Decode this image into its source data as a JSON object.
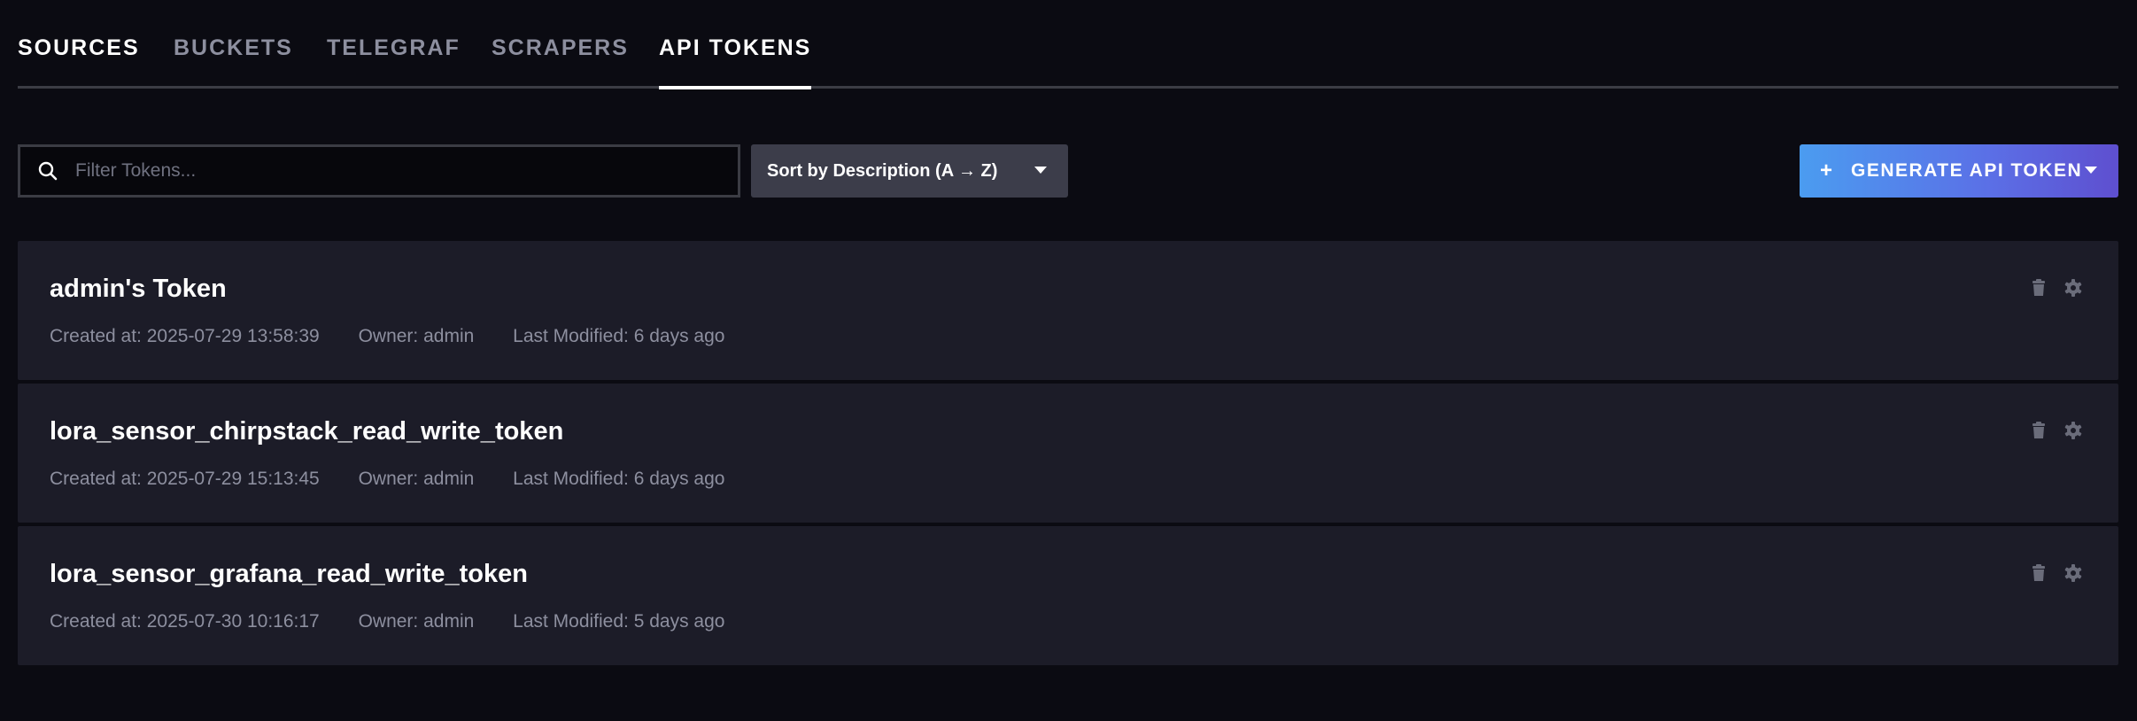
{
  "tabs": [
    {
      "label": "SOURCES",
      "state": "inactive-bright"
    },
    {
      "label": "BUCKETS",
      "state": "inactive"
    },
    {
      "label": "TELEGRAF",
      "state": "inactive"
    },
    {
      "label": "SCRAPERS",
      "state": "inactive"
    },
    {
      "label": "API TOKENS",
      "state": "active"
    }
  ],
  "toolbar": {
    "search_placeholder": "Filter Tokens...",
    "search_icon": "search-icon",
    "sort_label": "Sort by Description (A → Z)",
    "generate_label": "GENERATE API TOKEN",
    "generate_plus": "+"
  },
  "tokens": [
    {
      "name": "admin's Token",
      "created": "Created at: 2025-07-29 13:58:39",
      "owner": "Owner: admin",
      "modified": "Last Modified: 6 days ago"
    },
    {
      "name": "lora_sensor_chirpstack_read_write_token",
      "created": "Created at: 2025-07-29 15:13:45",
      "owner": "Owner: admin",
      "modified": "Last Modified: 6 days ago"
    },
    {
      "name": "lora_sensor_grafana_read_write_token",
      "created": "Created at: 2025-07-30 10:16:17",
      "owner": "Owner: admin",
      "modified": "Last Modified: 5 days ago"
    }
  ],
  "colors": {
    "background": "#0b0b12",
    "card": "#1c1c28",
    "accent_start": "#4b9cf0",
    "accent_end": "#5e4fcf",
    "muted_text": "#8d8f9f",
    "icon_gray": "#6a6c7a"
  }
}
